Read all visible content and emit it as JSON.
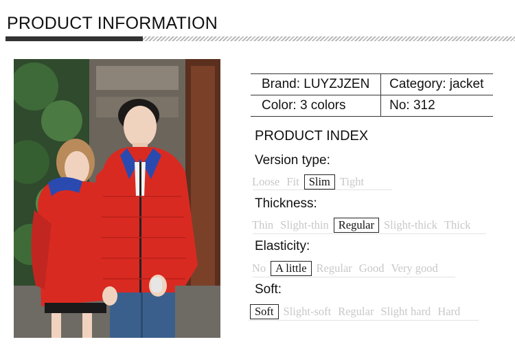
{
  "header": {
    "title": "PRODUCT INFORMATION"
  },
  "info": {
    "brand": "Brand: LUYZJZEN",
    "category": "Category: jacket",
    "color": "Color: 3 colors",
    "number": "No: 312"
  },
  "index": {
    "title": "PRODUCT INDEX",
    "version": {
      "label": "Version type:",
      "options": [
        "Loose",
        "Fit",
        "Slim",
        "Tight"
      ],
      "selected": "Slim"
    },
    "thickness": {
      "label": "Thickness:",
      "options": [
        "Thin",
        "Slight-thin",
        "Regular",
        "Slight-thick",
        "Thick"
      ],
      "selected": "Regular"
    },
    "elasticity": {
      "label": "Elasticity:",
      "options": [
        "No",
        "A little",
        "Regular",
        "Good",
        "Very good"
      ],
      "selected": "A little"
    },
    "soft": {
      "label": "Soft:",
      "options": [
        "Soft",
        "Slight-soft",
        "Regular",
        "Slight hard",
        "Hard"
      ],
      "selected": "Soft"
    }
  },
  "colors": {
    "jacket": "#d92a22",
    "selected_text": "#111111",
    "unselected_text": "#c8c8c8"
  }
}
